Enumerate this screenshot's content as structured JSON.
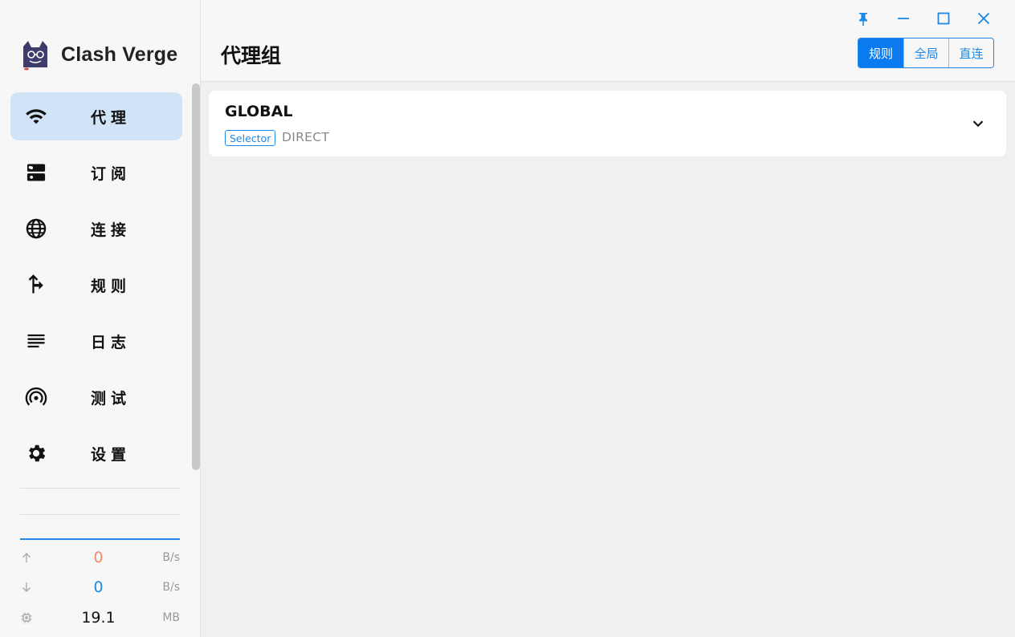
{
  "app": {
    "name": "Clash Verge"
  },
  "nav": {
    "items": [
      {
        "label": "代理",
        "icon": "wifi-icon",
        "active": true
      },
      {
        "label": "订阅",
        "icon": "server-icon",
        "active": false
      },
      {
        "label": "连接",
        "icon": "globe-icon",
        "active": false
      },
      {
        "label": "规则",
        "icon": "route-arrow-icon",
        "active": false
      },
      {
        "label": "日志",
        "icon": "list-lines-icon",
        "active": false
      },
      {
        "label": "测试",
        "icon": "broadcast-icon",
        "active": false
      },
      {
        "label": "设置",
        "icon": "gear-icon",
        "active": false
      }
    ]
  },
  "traffic": {
    "upload": {
      "value": "0",
      "unit": "B/s",
      "color": "#f08a6a"
    },
    "download": {
      "value": "0",
      "unit": "B/s",
      "color": "#1e88e5"
    },
    "memory": {
      "value": "19.1",
      "unit": "MB"
    }
  },
  "header": {
    "title": "代理组"
  },
  "mode": {
    "options": [
      "规则",
      "全局",
      "直连"
    ],
    "selected": "规则"
  },
  "groups": [
    {
      "name": "GLOBAL",
      "type": "Selector",
      "now": "DIRECT"
    }
  ],
  "colors": {
    "accent": "#1e88e5",
    "active_bg": "#d0e3f7",
    "active_button": "#0a7aee"
  }
}
